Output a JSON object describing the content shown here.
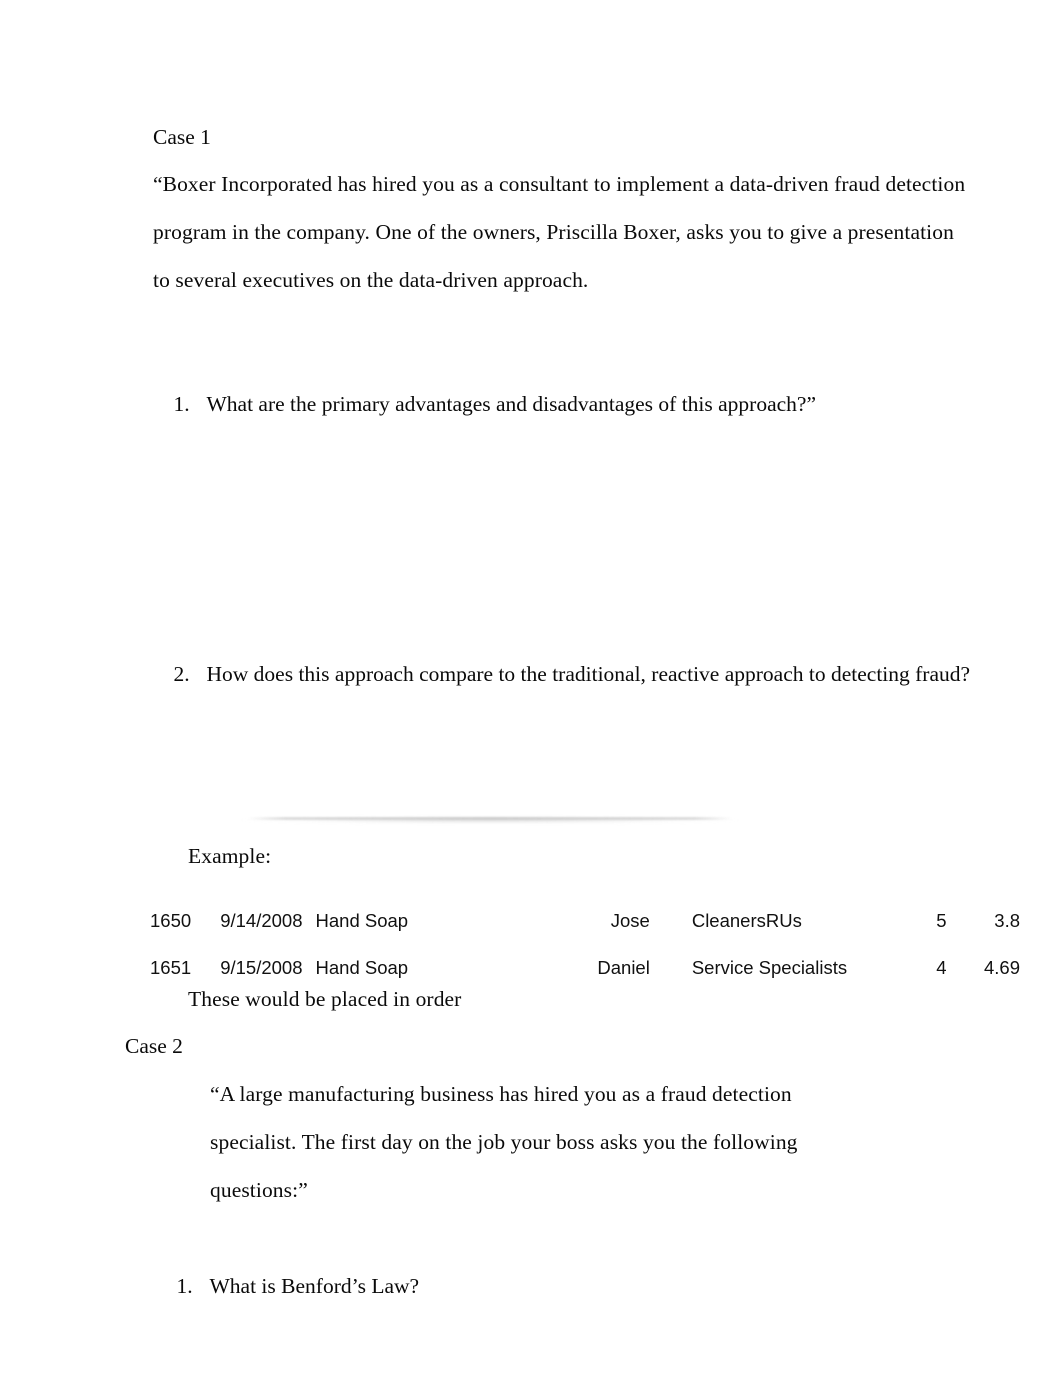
{
  "document": {
    "case1": {
      "heading": "Case 1",
      "quote_lines": [
        "“Boxer Incorporated has hired you as a consultant to implement a data-driven fraud detection",
        "program in the company. One of the owners, Priscilla Boxer, asks you to give a presentation",
        "to several executives on the data-driven approach."
      ],
      "questions": [
        {
          "marker": "1.",
          "text": "What are the primary advantages and disadvantages of this approach?”"
        },
        {
          "marker": "2.",
          "text": "How does this approach compare to the traditional, reactive approach to detecting fraud?"
        }
      ]
    },
    "example": {
      "label": "Example:",
      "note": "These would be placed in order",
      "table": {
        "rows": [
          {
            "id": "1650",
            "date": "9/14/2008",
            "item": "Hand Soap",
            "person": "Jose",
            "vendor": "CleanersRUs",
            "quantity": "5",
            "amount": "3.8"
          },
          {
            "id": "1651",
            "date": "9/15/2008",
            "item": "Hand Soap",
            "person": "Daniel",
            "vendor": "Service Specialists",
            "quantity": "4",
            "amount": "4.69"
          }
        ]
      }
    },
    "case2": {
      "heading": "Case 2",
      "quote_lines": [
        "“A large manufacturing business has hired you as a fraud detection",
        "specialist. The first day on the job your boss asks you the following",
        "questions:”"
      ],
      "questions": [
        {
          "marker": "1.",
          "text": "What is Benford’s Law?"
        }
      ]
    }
  }
}
